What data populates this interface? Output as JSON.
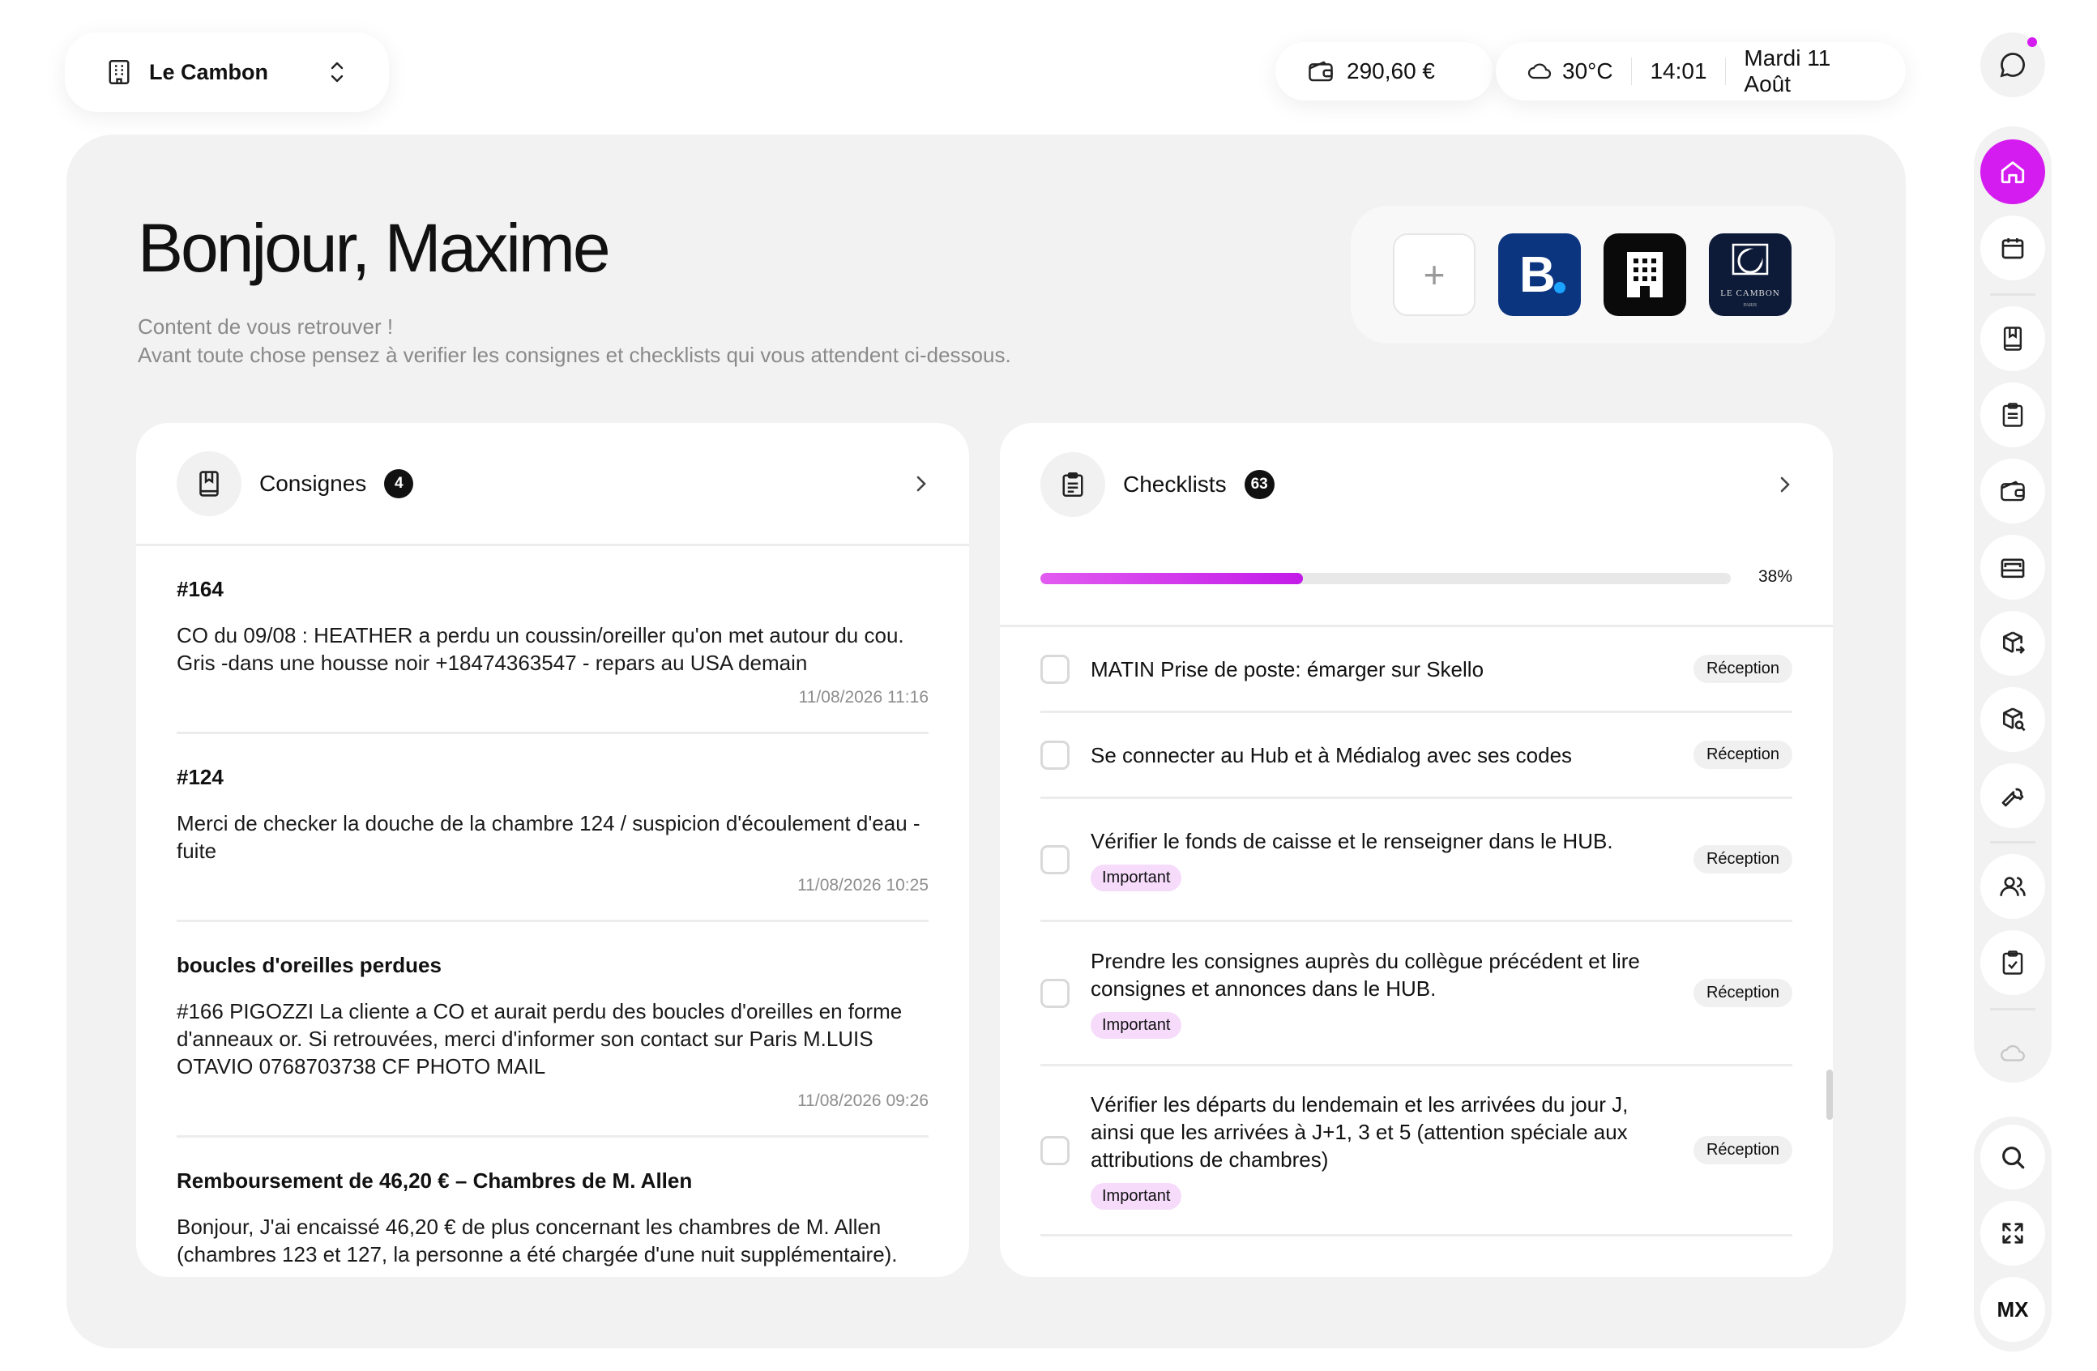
{
  "header": {
    "hotel_name": "Le Cambon",
    "balance": "290,60 €",
    "temperature": "30°C",
    "time": "14:01",
    "date": "Mardi 11 Août"
  },
  "main": {
    "greeting": "Bonjour, Maxime",
    "subtitle_line1": "Content de vous retrouver !",
    "subtitle_line2": "Avant toute chose pensez à verifier les consignes et checklists qui vous attendent ci-dessous.",
    "apps": {
      "add_symbol": "+",
      "booking_letter": "B",
      "cambon_logo_line1": "LE CAMBON",
      "cambon_logo_line2": "PARIS"
    }
  },
  "consignes": {
    "title": "Consignes",
    "count": "4",
    "items": [
      {
        "title": "#164",
        "text": "CO du 09/08 : HEATHER a perdu un coussin/oreiller qu'on met autour du cou. Gris -dans une housse noir +18474363547 - repars au USA demain",
        "timestamp": "11/08/2026 11:16"
      },
      {
        "title": "#124",
        "text": "Merci de checker la douche de la chambre 124 / suspicion d'écoulement d'eau - fuite",
        "timestamp": "11/08/2026 10:25"
      },
      {
        "title": "boucles d'oreilles perdues",
        "text": "#166 PIGOZZI La cliente a CO et aurait perdu des boucles d'oreilles en forme d'anneaux or. Si retrouvées, merci d'informer son contact sur Paris M.LUIS OTAVIO 0768703738 CF PHOTO MAIL",
        "timestamp": "11/08/2026 09:26"
      },
      {
        "title": "Remboursement de 46,20 € – Chambres de M. Allen",
        "text": "Bonjour, J'ai encaissé 46,20 € de plus concernant les chambres de M. Allen (chambres 123 et 127, la personne a été chargée d'une nuit supplémentaire).",
        "timestamp": ""
      }
    ]
  },
  "checklists": {
    "title": "Checklists",
    "count": "63",
    "progress_label": "38%",
    "progress_value": 0.38,
    "important_label": "Important",
    "items": [
      {
        "text": "MATIN Prise de poste: émarger sur Skello",
        "tag": "Réception",
        "important": false
      },
      {
        "text": "Se connecter au Hub et à Médialog avec ses codes",
        "tag": "Réception",
        "important": false
      },
      {
        "text": "Vérifier le fonds de caisse et le renseigner dans le HUB.",
        "tag": "Réception",
        "important": true
      },
      {
        "text": "Prendre les consignes auprès du collègue précédent et lire consignes et annonces dans le HUB.",
        "tag": "Réception",
        "important": true
      },
      {
        "text": "Vérifier les départs du lendemain et les arrivées du jour J, ainsi que les arrivées à J+1, 3 et 5 (attention spéciale aux attributions de chambres)",
        "tag": "Réception",
        "important": true
      }
    ]
  },
  "rail": {
    "user_initials": "MX"
  },
  "colors": {
    "accent": "#d51cf0",
    "important_bg": "#f6dbfb",
    "panel_bg": "#f2f2f2"
  }
}
